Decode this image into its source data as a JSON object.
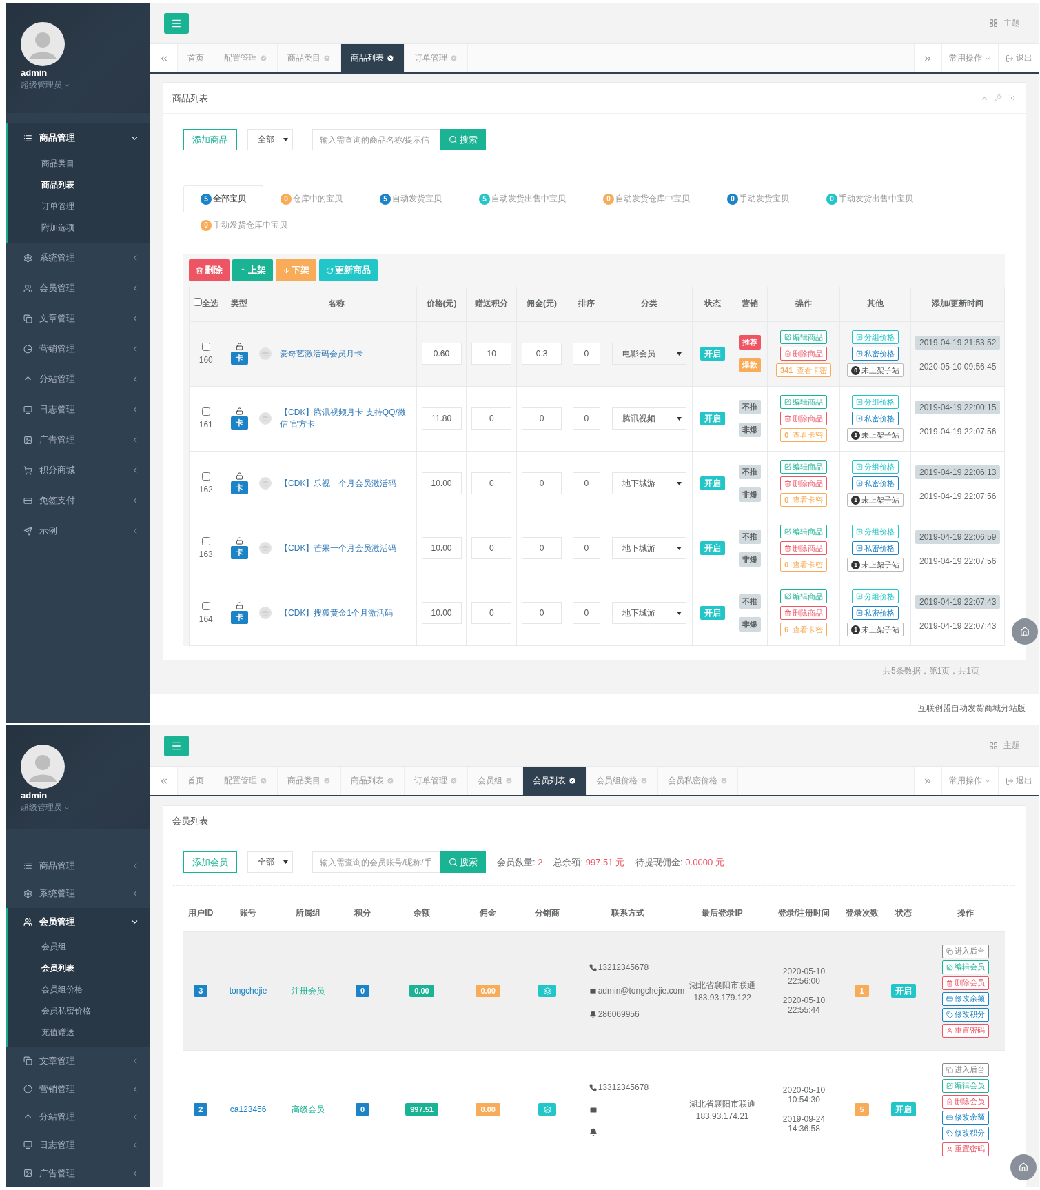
{
  "screens": [
    {
      "kind": "goods",
      "sidebar": {
        "user": {
          "name": "admin",
          "role": "超级管理员"
        },
        "menu": [
          {
            "label": "商品管理",
            "expanded": true,
            "children": [
              {
                "label": "商品类目",
                "selected": false
              },
              {
                "label": "商品列表",
                "selected": true
              },
              {
                "label": "订单管理",
                "selected": false
              },
              {
                "label": "附加选项",
                "selected": false
              }
            ]
          },
          {
            "label": "系统管理",
            "expanded": false
          },
          {
            "label": "会员管理",
            "expanded": false
          },
          {
            "label": "文章管理",
            "expanded": false
          },
          {
            "label": "营销管理",
            "expanded": false
          },
          {
            "label": "分站管理",
            "expanded": false
          },
          {
            "label": "日志管理",
            "expanded": false
          },
          {
            "label": "广告管理",
            "expanded": false
          },
          {
            "label": "积分商城",
            "expanded": false
          },
          {
            "label": "免签支付",
            "expanded": false
          },
          {
            "label": "示例",
            "expanded": false
          }
        ]
      },
      "topbar": {
        "theme": "主题"
      },
      "tabs": [
        {
          "label": "首页",
          "selected": false,
          "closable": false
        },
        {
          "label": "配置管理",
          "selected": false,
          "closable": true
        },
        {
          "label": "商品类目",
          "selected": false,
          "closable": true
        },
        {
          "label": "商品列表",
          "selected": true,
          "closable": true
        },
        {
          "label": "订单管理",
          "selected": false,
          "closable": true
        }
      ],
      "tab_tools": {
        "common_ops": "常用操作",
        "logout": "退出"
      },
      "panel": {
        "title": "商品列表",
        "add_button": "添加商品",
        "filter": "全部",
        "search_placeholder": "输入需查询的商品名称/提示信",
        "search_button": "搜索",
        "filter_tabs": [
          {
            "count": "5",
            "label": "全部宝贝",
            "color": "#1c84c6",
            "selected": true
          },
          {
            "count": "0",
            "label": "仓库中的宝贝",
            "color": "#f8ac59",
            "selected": false
          },
          {
            "count": "5",
            "label": "自动发货宝贝",
            "color": "#1c84c6",
            "selected": false
          },
          {
            "count": "5",
            "label": "自动发货出售中宝贝",
            "color": "#23c6c8",
            "selected": false
          },
          {
            "count": "0",
            "label": "自动发货仓库中宝贝",
            "color": "#f8ac59",
            "selected": false
          },
          {
            "count": "0",
            "label": "手动发货宝贝",
            "color": "#1c84c6",
            "selected": false
          },
          {
            "count": "0",
            "label": "手动发货出售中宝贝",
            "color": "#23c6c8",
            "selected": false
          },
          {
            "count": "0",
            "label": "手动发货仓库中宝贝",
            "color": "#f8ac59",
            "selected": false
          }
        ],
        "bulk_buttons": [
          {
            "kind": "delete",
            "label": "删除"
          },
          {
            "kind": "up",
            "label": "上架"
          },
          {
            "kind": "down",
            "label": "下架"
          },
          {
            "kind": "refresh",
            "label": "更新商品"
          }
        ],
        "select_all_checked": false,
        "columns": [
          "全选",
          "类型",
          "名称",
          "价格(元)",
          "赠送积分",
          "佣金(元)",
          "排序",
          "分类",
          "状态",
          "营销",
          "操作",
          "其他",
          "添加/更新时间"
        ],
        "rows": [
          {
            "checked": false,
            "id": "160",
            "type": "卡",
            "name": "爱奇艺激活码会员月卡",
            "price": "0.60",
            "points": "10",
            "commission": "0.3",
            "sort": "0",
            "category": "电影会员",
            "status": {
              "label": "开启",
              "on": true
            },
            "tags": [
              {
                "label": "推荐",
                "on": true
              },
              {
                "label": "爆款",
                "on": true
              }
            ],
            "edit": "编辑商品",
            "delete": "删除商品",
            "card_count": "341",
            "card_label": "查看卡密",
            "group_price": "分组价格",
            "private_price": "私密价格",
            "sub_count": "0",
            "sub_label": "未上架子站",
            "added": "2019-04-19 21:53:52",
            "updated": "2020-05-10 09:56:45"
          },
          {
            "checked": false,
            "id": "161",
            "type": "卡",
            "name": "【CDK】腾讯视频月卡 支持QQ/微信 官方卡",
            "price": "11.80",
            "points": "0",
            "commission": "0",
            "sort": "0",
            "category": "腾讯视频",
            "status": {
              "label": "开启",
              "on": true
            },
            "tags": [
              {
                "label": "不推",
                "on": false
              },
              {
                "label": "非爆",
                "on": false
              }
            ],
            "edit": "编辑商品",
            "delete": "删除商品",
            "card_count": "0",
            "card_label": "查看卡密",
            "group_price": "分组价格",
            "private_price": "私密价格",
            "sub_count": "1",
            "sub_label": "未上架子站",
            "added": "2019-04-19 22:00:15",
            "updated": "2019-04-19 22:07:56"
          },
          {
            "checked": false,
            "id": "162",
            "type": "卡",
            "name": "【CDK】乐视一个月会员激活码",
            "price": "10.00",
            "points": "0",
            "commission": "0",
            "sort": "0",
            "category": "地下城游",
            "status": {
              "label": "开启",
              "on": true
            },
            "tags": [
              {
                "label": "不推",
                "on": false
              },
              {
                "label": "非爆",
                "on": false
              }
            ],
            "edit": "编辑商品",
            "delete": "删除商品",
            "card_count": "0",
            "card_label": "查看卡密",
            "group_price": "分组价格",
            "private_price": "私密价格",
            "sub_count": "1",
            "sub_label": "未上架子站",
            "added": "2019-04-19 22:06:13",
            "updated": "2019-04-19 22:07:56"
          },
          {
            "checked": false,
            "id": "163",
            "type": "卡",
            "name": "【CDK】芒果一个月会员激活码",
            "price": "10.00",
            "points": "0",
            "commission": "0",
            "sort": "0",
            "category": "地下城游",
            "status": {
              "label": "开启",
              "on": true
            },
            "tags": [
              {
                "label": "不推",
                "on": false
              },
              {
                "label": "非爆",
                "on": false
              }
            ],
            "edit": "编辑商品",
            "delete": "删除商品",
            "card_count": "0",
            "card_label": "查看卡密",
            "group_price": "分组价格",
            "private_price": "私密价格",
            "sub_count": "1",
            "sub_label": "未上架子站",
            "added": "2019-04-19 22:06:59",
            "updated": "2019-04-19 22:07:56"
          },
          {
            "checked": false,
            "id": "164",
            "type": "卡",
            "name": "【CDK】搜狐黄金1个月激活码",
            "price": "10.00",
            "points": "0",
            "commission": "0",
            "sort": "0",
            "category": "地下城游",
            "status": {
              "label": "开启",
              "on": true
            },
            "tags": [
              {
                "label": "不推",
                "on": false
              },
              {
                "label": "非爆",
                "on": false
              }
            ],
            "edit": "编辑商品",
            "delete": "删除商品",
            "card_count": "6",
            "card_label": "查看卡密",
            "group_price": "分组价格",
            "private_price": "私密价格",
            "sub_count": "1",
            "sub_label": "未上架子站",
            "added": "2019-04-19 22:07:43",
            "updated": "2019-04-19 22:07:43"
          }
        ],
        "pagination": "共5条数据，第1页，共1页"
      },
      "footer": "互联创盟自动发货商城分站版"
    },
    {
      "kind": "members",
      "sidebar": {
        "user": {
          "name": "admin",
          "role": "超级管理员"
        },
        "menu": [
          {
            "label": "商品管理",
            "expanded": false
          },
          {
            "label": "系统管理",
            "expanded": false
          },
          {
            "label": "会员管理",
            "expanded": true,
            "children": [
              {
                "label": "会员组",
                "selected": false
              },
              {
                "label": "会员列表",
                "selected": true
              },
              {
                "label": "会员组价格",
                "selected": false
              },
              {
                "label": "会员私密价格",
                "selected": false
              },
              {
                "label": "充值赠送",
                "selected": false
              }
            ]
          },
          {
            "label": "文章管理",
            "expanded": false
          },
          {
            "label": "营销管理",
            "expanded": false
          },
          {
            "label": "分站管理",
            "expanded": false
          },
          {
            "label": "日志管理",
            "expanded": false
          },
          {
            "label": "广告管理",
            "expanded": false
          }
        ]
      },
      "topbar": {
        "theme": "主题"
      },
      "tabs": [
        {
          "label": "首页",
          "selected": false,
          "closable": false
        },
        {
          "label": "配置管理",
          "selected": false,
          "closable": true
        },
        {
          "label": "商品类目",
          "selected": false,
          "closable": true
        },
        {
          "label": "商品列表",
          "selected": false,
          "closable": true
        },
        {
          "label": "订单管理",
          "selected": false,
          "closable": true
        },
        {
          "label": "会员组",
          "selected": false,
          "closable": true
        },
        {
          "label": "会员列表",
          "selected": true,
          "closable": true
        },
        {
          "label": "会员组价格",
          "selected": false,
          "closable": true
        },
        {
          "label": "会员私密价格",
          "selected": false,
          "closable": true
        }
      ],
      "tab_tools": {
        "common_ops": "常用操作",
        "logout": "退出"
      },
      "panel": {
        "title": "会员列表",
        "add_button": "添加会员",
        "filter": "全部",
        "search_placeholder": "输入需查询的会员账号/昵称/手",
        "search_button": "搜索",
        "stats": [
          {
            "label": "会员数量:",
            "value": "2"
          },
          {
            "label": "总余额:",
            "value": "997.51 元"
          },
          {
            "label": "待提现佣金:",
            "value": "0.0000 元"
          }
        ],
        "columns": [
          "用户ID",
          "账号",
          "所属组",
          "积分",
          "余额",
          "佣金",
          "分销商",
          "联系方式",
          "最后登录IP",
          "登录/注册时间",
          "登录次数",
          "状态",
          "操作"
        ],
        "rows": [
          {
            "highlighted": true,
            "id": "3",
            "account": "tongchejie",
            "group": "注册会员",
            "points": "0",
            "balance": "0.00",
            "commission": "0.00",
            "phone": "13212345678",
            "email": "admin@tongchejie.com",
            "qq": "286069956",
            "ip_location": "湖北省襄阳市联通",
            "ip": "183.93.179.122",
            "login_time": "2020-05-10 22:56:00",
            "register_time": "2020-05-10 22:55:44",
            "login_count": "1",
            "status": {
              "label": "开启",
              "on": true
            },
            "actions": [
              {
                "kind": "backend",
                "label": "进入后台"
              },
              {
                "kind": "edit",
                "label": "编辑会员"
              },
              {
                "kind": "delete",
                "label": "删除会员"
              },
              {
                "kind": "balance",
                "label": "修改余额"
              },
              {
                "kind": "points",
                "label": "修改积分"
              },
              {
                "kind": "password",
                "label": "重置密码"
              }
            ]
          },
          {
            "highlighted": false,
            "id": "2",
            "account": "ca123456",
            "group": "高级会员",
            "points": "0",
            "balance": "997.51",
            "commission": "0.00",
            "phone": "13312345678",
            "ip_location": "湖北省襄阳市联通",
            "ip": "183.93.174.21",
            "login_time": "2020-05-10 10:54:30",
            "register_time": "2019-09-24 14:36:58",
            "login_count": "5",
            "status": {
              "label": "开启",
              "on": true
            },
            "actions": [
              {
                "kind": "backend",
                "label": "进入后台"
              },
              {
                "kind": "edit",
                "label": "编辑会员"
              },
              {
                "kind": "delete",
                "label": "删除会员"
              },
              {
                "kind": "balance",
                "label": "修改余额"
              },
              {
                "kind": "points",
                "label": "修改积分"
              },
              {
                "kind": "password",
                "label": "重置密码"
              }
            ]
          }
        ]
      }
    }
  ]
}
